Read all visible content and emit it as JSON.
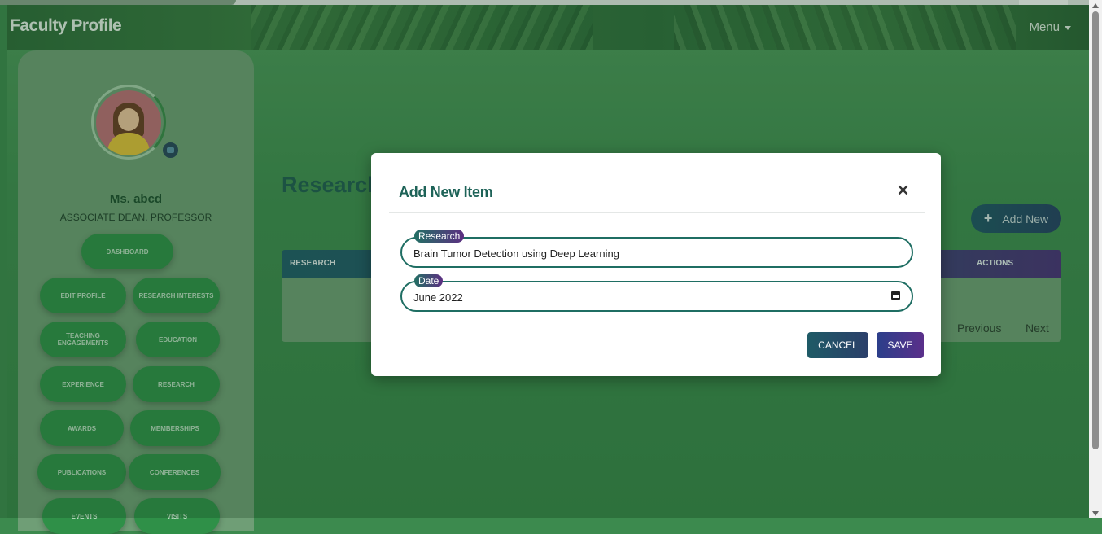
{
  "header": {
    "brand": "Faculty Profile",
    "menu_label": "Menu"
  },
  "profile": {
    "name": "Ms. abcd",
    "role": "ASSOCIATE DEAN. PROFESSOR"
  },
  "sidebar": {
    "dashboard": "DASHBOARD",
    "items": [
      "EDIT PROFILE",
      "RESEARCH INTERESTS",
      "TEACHING ENGAGEMENTS",
      "EDUCATION",
      "EXPERIENCE",
      "RESEARCH",
      "AWARDS",
      "MEMBERSHIPS",
      "PUBLICATIONS",
      "CONFERENCES",
      "EVENTS",
      "VISITS"
    ]
  },
  "main": {
    "section_title": "Research",
    "add_new_label": "Add New",
    "table": {
      "columns": [
        "RESEARCH",
        "ACTIONS"
      ]
    },
    "pagination": {
      "previous": "Previous",
      "next": "Next"
    }
  },
  "modal": {
    "title": "Add New Item",
    "close_symbol": "✕",
    "fields": [
      {
        "label": "Research",
        "value": "Brain Tumor Detection using Deep Learning"
      },
      {
        "label": "Date",
        "value": "June 2022"
      }
    ],
    "cancel_label": "CANCEL",
    "save_label": "SAVE"
  },
  "icons": [
    "camera-icon",
    "plus-icon",
    "close-icon",
    "calendar-icon",
    "caret-down-icon"
  ]
}
